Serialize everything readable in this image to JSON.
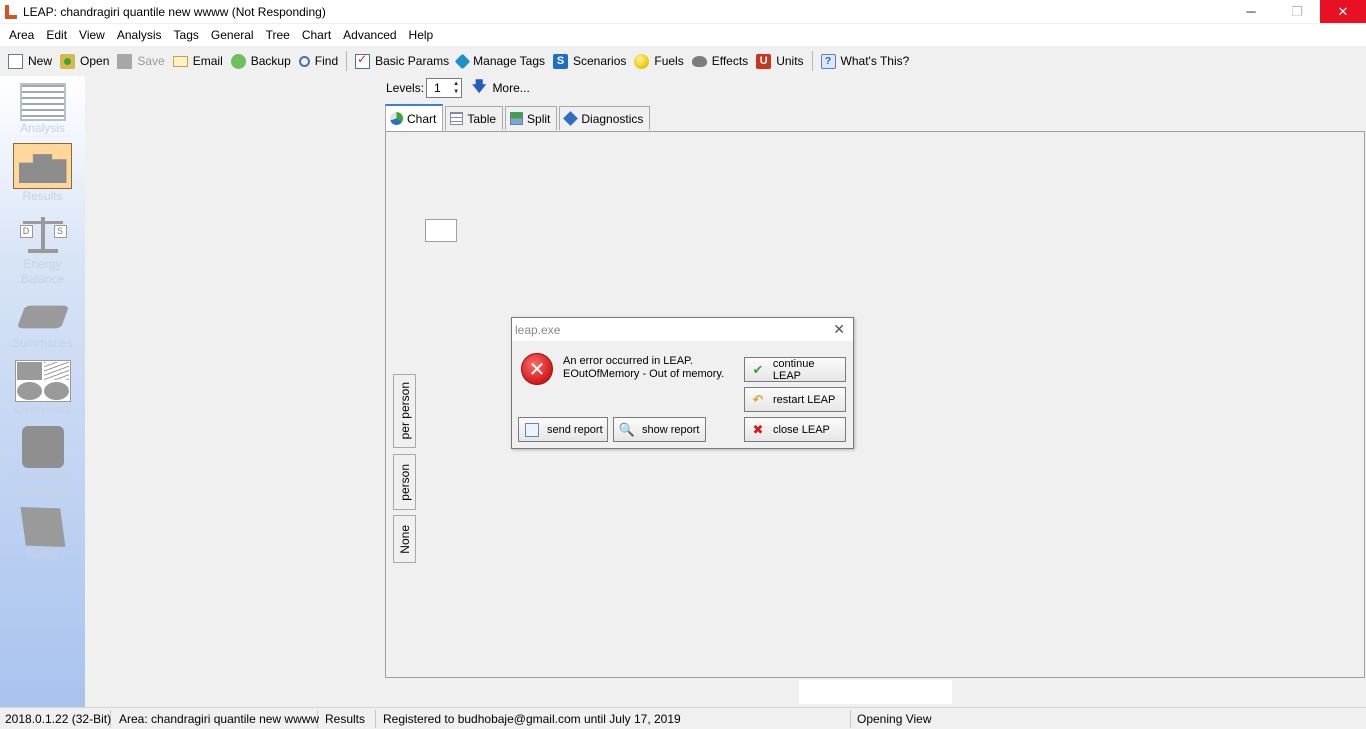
{
  "window": {
    "title": "LEAP: chandragiri quantile new wwww (Not Responding)",
    "minimize": "─",
    "restore": "❐",
    "close": "✕"
  },
  "menu": [
    "Area",
    "Edit",
    "View",
    "Analysis",
    "Tags",
    "General",
    "Tree",
    "Chart",
    "Advanced",
    "Help"
  ],
  "toolbar": {
    "new": "New",
    "open": "Open",
    "save": "Save",
    "email": "Email",
    "backup": "Backup",
    "find": "Find",
    "basic_params": "Basic Params",
    "manage_tags": "Manage Tags",
    "scenarios": "Scenarios",
    "fuels": "Fuels",
    "effects": "Effects",
    "units": "Units",
    "whats_this": "What's This?",
    "scenarios_glyph": "S",
    "units_glyph": "U",
    "help_glyph": "?"
  },
  "sidebar": {
    "analysis": "Analysis",
    "results": "Results",
    "energy_balance_1": "Energy",
    "energy_balance_2": "Balance",
    "summaries": "Summaries",
    "overviews": "Overviews",
    "technology_1": "Technology",
    "technology_2": "Database",
    "notes": "Notes",
    "balance_d": "D",
    "balance_s": "S"
  },
  "levels": {
    "label": "Levels:",
    "value": "1",
    "more": "More..."
  },
  "tabs": [
    "Chart",
    "Table",
    "Split",
    "Diagnostics"
  ],
  "vertical_tabs": [
    "per person",
    "person",
    "None"
  ],
  "dialog": {
    "title": "leap.exe",
    "close_glyph": "✕",
    "error_glyph": "✕",
    "message_line1": "An error occurred in LEAP.",
    "message_line2": "EOutOfMemory - Out of memory.",
    "continue": "continue LEAP",
    "restart": "restart LEAP",
    "close": "close LEAP",
    "send_report": "send report",
    "show_report": "show report"
  },
  "statusbar": {
    "version": "2018.0.1.22 (32-Bit)",
    "area": "Area: chandragiri quantile new wwww",
    "view": "Results",
    "registration": "Registered to budhobaje@gmail.com until July 17, 2019",
    "status": "Opening View"
  }
}
